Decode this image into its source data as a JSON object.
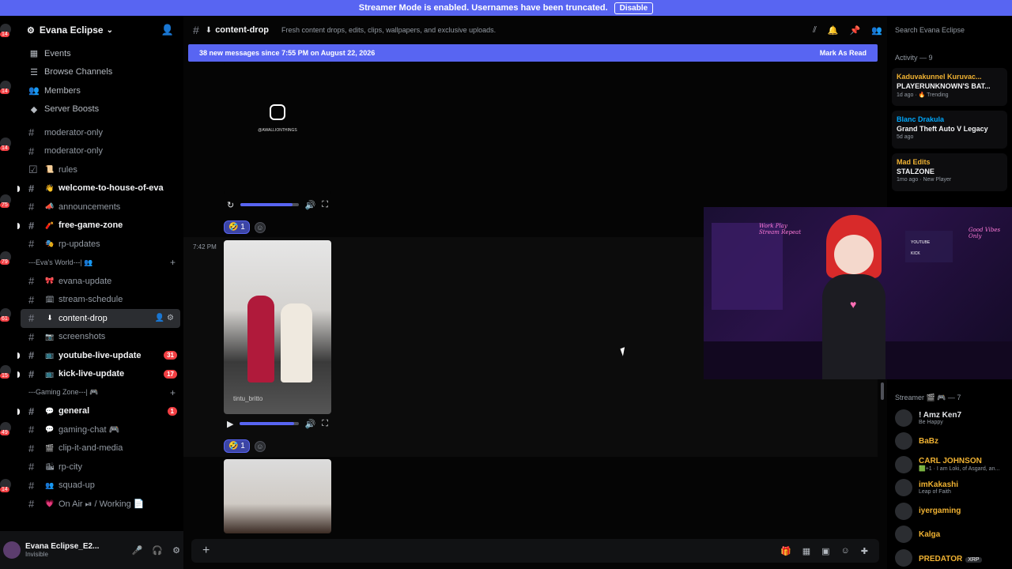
{
  "banner": {
    "text": "Streamer Mode is enabled. Usernames have been truncated.",
    "disable_label": "Disable"
  },
  "server": {
    "name": "Evana Eclipse"
  },
  "server_badges": [
    "14",
    "14",
    "14",
    "75",
    "79",
    "61",
    "15",
    "49",
    "14"
  ],
  "nav": [
    {
      "label": "Events",
      "icon": "calendar-icon"
    },
    {
      "label": "Browse Channels",
      "icon": "browse-channels-icon"
    },
    {
      "label": "Members",
      "icon": "members-icon"
    },
    {
      "label": "Server Boosts",
      "icon": "boost-icon"
    }
  ],
  "channels": [
    {
      "type": "channel",
      "name": "moderator-only",
      "emoji": ""
    },
    {
      "type": "channel",
      "name": "moderator-only",
      "emoji": ""
    },
    {
      "type": "channel",
      "name": "rules",
      "emoji": "📜",
      "rules": true
    },
    {
      "type": "channel",
      "name": "welcome-to-house-of-eva",
      "emoji": "👋",
      "unread": true
    },
    {
      "type": "channel",
      "name": "announcements",
      "emoji": "📣"
    },
    {
      "type": "channel",
      "name": "free-game-zone",
      "emoji": "🧨",
      "unread": true
    },
    {
      "type": "channel",
      "name": "rp-updates",
      "emoji": "🎭"
    },
    {
      "type": "category",
      "name": "---Eva's World---| 👥"
    },
    {
      "type": "channel",
      "name": "evana-update",
      "emoji": "🎀"
    },
    {
      "type": "channel",
      "name": "stream-schedule",
      "emoji": "🗓"
    },
    {
      "type": "channel",
      "name": "content-drop",
      "emoji": "⬇",
      "active": true
    },
    {
      "type": "channel",
      "name": "screenshots",
      "emoji": "📷"
    },
    {
      "type": "channel",
      "name": "youtube-live-update",
      "emoji": "📺",
      "unread": true,
      "mention": "31"
    },
    {
      "type": "channel",
      "name": "kick-live-update",
      "emoji": "📺",
      "unread": true,
      "mention": "17"
    },
    {
      "type": "category",
      "name": "---Gaming Zone---| 🎮"
    },
    {
      "type": "channel",
      "name": "general",
      "emoji": "💬",
      "unread": true,
      "mention": "1"
    },
    {
      "type": "channel",
      "name": "gaming-chat 🎮",
      "emoji": "💬"
    },
    {
      "type": "channel",
      "name": "clip-it-and-media",
      "emoji": "🎬"
    },
    {
      "type": "channel",
      "name": "rp-city",
      "emoji": "🏙"
    },
    {
      "type": "channel",
      "name": "squad-up",
      "emoji": "👥"
    },
    {
      "type": "channel",
      "name": "On Air ⏯ / Working 📄",
      "emoji": "💗"
    }
  ],
  "user": {
    "name": "Evana Eclipse_E2...",
    "status": "Invisible"
  },
  "channel_header": {
    "name": "content-drop",
    "topic": "Fresh content drops, edits, clips, wallpapers, and exclusive uploads."
  },
  "new_messages": {
    "text": "38 new messages since 7:55 PM on August 22, 2026",
    "mark_label": "Mark As Read"
  },
  "messages": {
    "video1_handle": "@AWALLIONTHINGS",
    "reaction1": {
      "emoji": "🤣",
      "count": "1"
    },
    "timestamp2": "7:42 PM",
    "video2_caption": "tintu_britto",
    "reaction2": {
      "emoji": "🤣",
      "count": "1"
    }
  },
  "search": {
    "placeholder": "Search Evana Eclipse"
  },
  "activity": {
    "title": "Activity — 9",
    "items": [
      {
        "name": "Kaduvakunnel Kuruvac...",
        "game": "PLAYERUNKNOWN'S BAT...",
        "meta": "1d ago · 🔥 Trending",
        "color": "#f0b232"
      },
      {
        "name": "Blanc Drakula",
        "game": "Grand Theft Auto V Legacy",
        "meta": "5d ago",
        "color": "#00a8fc"
      },
      {
        "name": "Mad Edits",
        "game": "STALZONE",
        "meta": "1mo ago · New Player",
        "color": "#f0b232"
      }
    ]
  },
  "members": {
    "title": "Streamer 🎬 🎮 — 7",
    "list": [
      {
        "name": "! Amz Ken7",
        "status": "Be Happy",
        "color": "#e3e5e8"
      },
      {
        "name": "BaBz",
        "status": "",
        "color": "#f0b232"
      },
      {
        "name": "CARL JOHNSON",
        "status": "🟩+1 · I am Loki, of Asgard, an...",
        "color": "#f0b232"
      },
      {
        "name": "imKakashi",
        "status": "Leap of Faith",
        "color": "#f0b232"
      },
      {
        "name": "iyergaming",
        "status": "",
        "color": "#f0b232"
      },
      {
        "name": "Kalga",
        "status": "",
        "color": "#f0b232"
      },
      {
        "name": "PREDATOR",
        "status": "",
        "tag": "XRP",
        "color": "#f0b232"
      }
    ]
  },
  "overlay": {
    "neon_left": "Work Play Stream Repeat",
    "neon_right": "Good Vibes Only",
    "screen_youtube": "YOUTUBE",
    "screen_kick": "KICK"
  }
}
